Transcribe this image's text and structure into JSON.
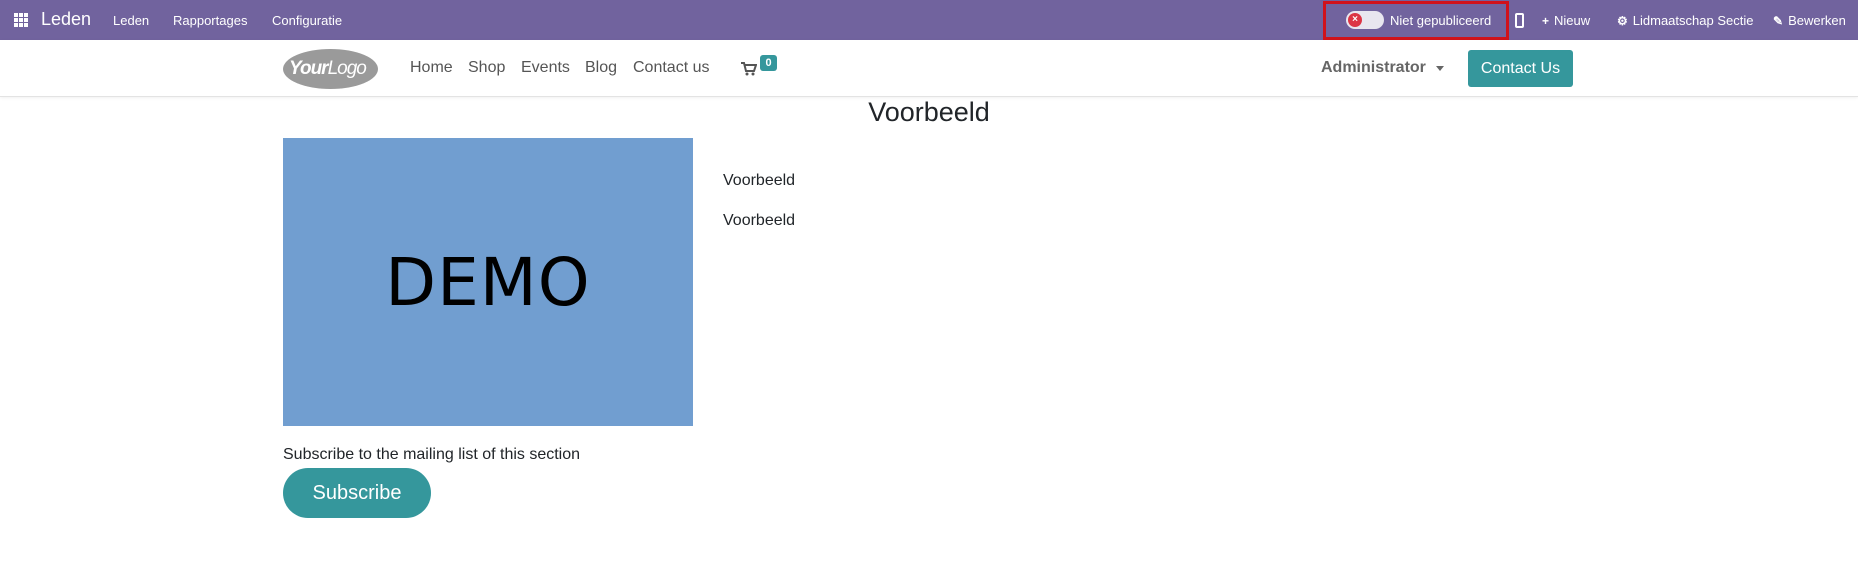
{
  "admin_bar": {
    "app_name": "Leden",
    "menu": [
      "Leden",
      "Rapportages",
      "Configuratie"
    ],
    "publish_toggle": {
      "label": "Niet gepubliceerd",
      "published": false,
      "state_icon": "x-icon"
    },
    "actions": [
      {
        "icon": "plus-icon",
        "label": "Nieuw"
      },
      {
        "icon": "gear-icon",
        "label": "Lidmaatschap Sectie"
      },
      {
        "icon": "pencil-icon",
        "label": "Bewerken"
      }
    ],
    "colors": {
      "bar": "#71639e",
      "highlight_border": "#d0121b",
      "toggle_off": "#dc3545"
    }
  },
  "header": {
    "logo_text": {
      "bold": "Your",
      "light": "Logo"
    },
    "nav": [
      "Home",
      "Shop",
      "Events",
      "Blog",
      "Contact us"
    ],
    "cart_count": "0",
    "user_menu": "Administrator",
    "cta_label": "Contact Us",
    "colors": {
      "accent": "#35979c"
    }
  },
  "main": {
    "title": "Voorbeeld",
    "image_text": "DEMO",
    "image_bg": "#719ed0",
    "paragraphs": [
      "Voorbeeld",
      "Voorbeeld"
    ],
    "subscribe_text": "Subscribe to the mailing list of this section",
    "subscribe_label": "Subscribe"
  }
}
